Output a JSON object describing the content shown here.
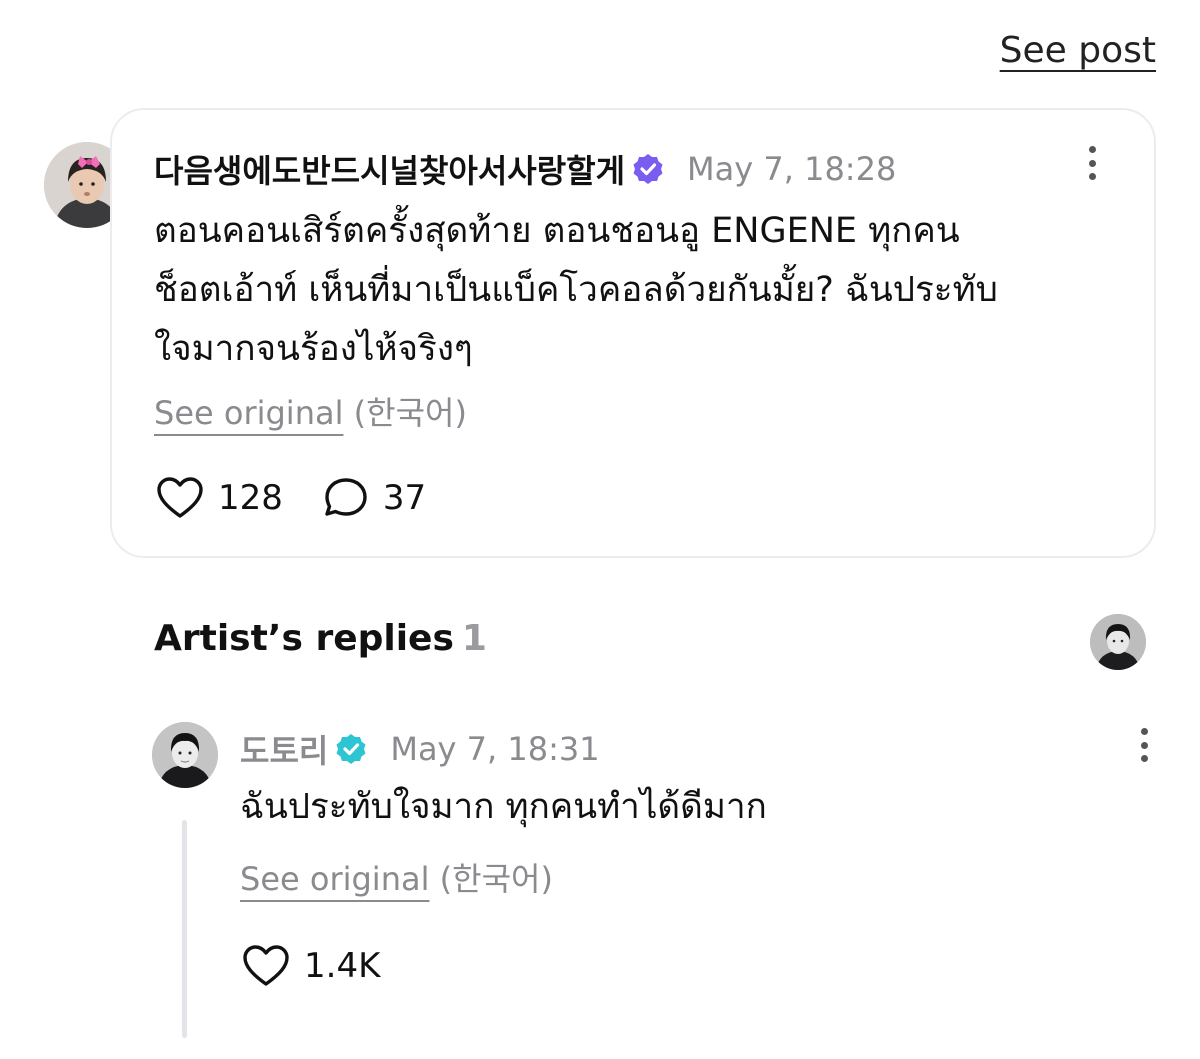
{
  "header": {
    "see_post": "See post"
  },
  "post": {
    "username": "다음생에도반드시널찾아서사랑할게",
    "timestamp": "May 7, 18:28",
    "body_lines": [
      "ตอนคอนเสิร์ตครั้งสุดท้าย ตอนชอนอู ENGENE ทุกคน",
      "ช็อตเอ้าท์ เห็นที่มาเป็นแบ็คโวคอลด้วยกันมั้ย? ฉันประทับ",
      "ใจมากจนร้องไห้จริงๆ"
    ],
    "see_original": "See original",
    "original_language": "(한국어)",
    "likes": "128",
    "comments": "37",
    "verified_color": "#7a5cf0"
  },
  "replies_section": {
    "title": "Artist’s replies",
    "count": "1"
  },
  "reply": {
    "username": "도토리",
    "timestamp": "May 7, 18:31",
    "body": "ฉันประทับใจมาก ทุกคนทำได้ดีมาก",
    "see_original": "See original",
    "original_language": "(한국어)",
    "likes": "1.4K",
    "verified_color": "#2ec5d3"
  },
  "icons": {
    "more": "more-vertical-icon",
    "like": "heart-icon",
    "comment": "comment-bubble-icon",
    "verified": "verified-badge-icon"
  }
}
